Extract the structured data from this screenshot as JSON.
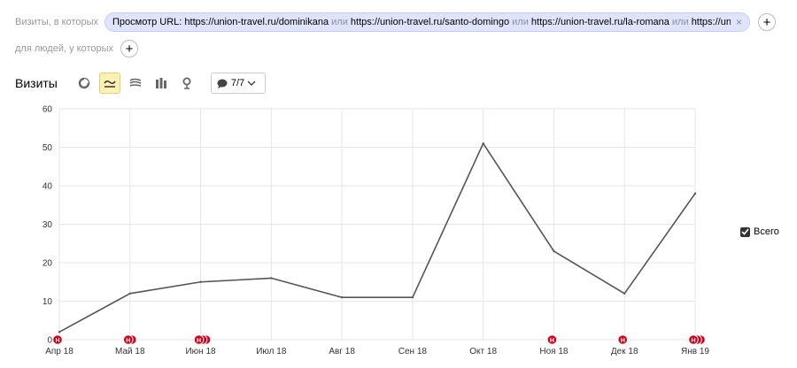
{
  "filters": {
    "visits_prefix": "Визиты, в которых",
    "chip_label": "Просмотр URL:",
    "chip_url1": "https://union-travel.ru/dominikana",
    "chip_or1": "или",
    "chip_url2": "https://union-travel.ru/santo-domingo",
    "chip_or2": "или",
    "chip_url3": "https://union-travel.ru/la-romana",
    "chip_or3": "или",
    "chip_url4": "https://union-travel....",
    "people_prefix": "для людей, у которых",
    "plus": "+",
    "close": "×"
  },
  "toolbar": {
    "title": "Визиты",
    "series_count": "7/7"
  },
  "legend": {
    "label": "Всего",
    "checked": true,
    "color": "#555555"
  },
  "colors": {
    "line": "#555555",
    "grid": "#e6e6e6",
    "marker": "#d6001c",
    "chip_bg": "#dfe3fb",
    "active_tab": "#fff0b3"
  },
  "chart_data": {
    "type": "line",
    "categories": [
      "Апр 18",
      "Май 18",
      "Июн 18",
      "Июл 18",
      "Авг 18",
      "Сен 18",
      "Окт 18",
      "Ноя 18",
      "Дек 18",
      "Янв 19"
    ],
    "series": [
      {
        "name": "Всего",
        "values": [
          2,
          12,
          15,
          16,
          11,
          11,
          51,
          23,
          12,
          38
        ]
      }
    ],
    "ylim": [
      0,
      60
    ],
    "yticks": [
      0,
      10,
      20,
      30,
      40,
      50,
      60
    ],
    "grid": true,
    "legend_position": "right",
    "annotations": [
      {
        "category": "Апр 18",
        "count": 1,
        "label": "Н"
      },
      {
        "category": "Май 18",
        "count": 2,
        "label": "Н"
      },
      {
        "category": "Июн 18",
        "count": 3,
        "label": "Н"
      },
      {
        "category": "Ноя 18",
        "count": 1,
        "label": "Н"
      },
      {
        "category": "Дек 18",
        "count": 1,
        "label": "Н"
      },
      {
        "category": "Янв 19",
        "count": 3,
        "label": "Н"
      }
    ]
  }
}
